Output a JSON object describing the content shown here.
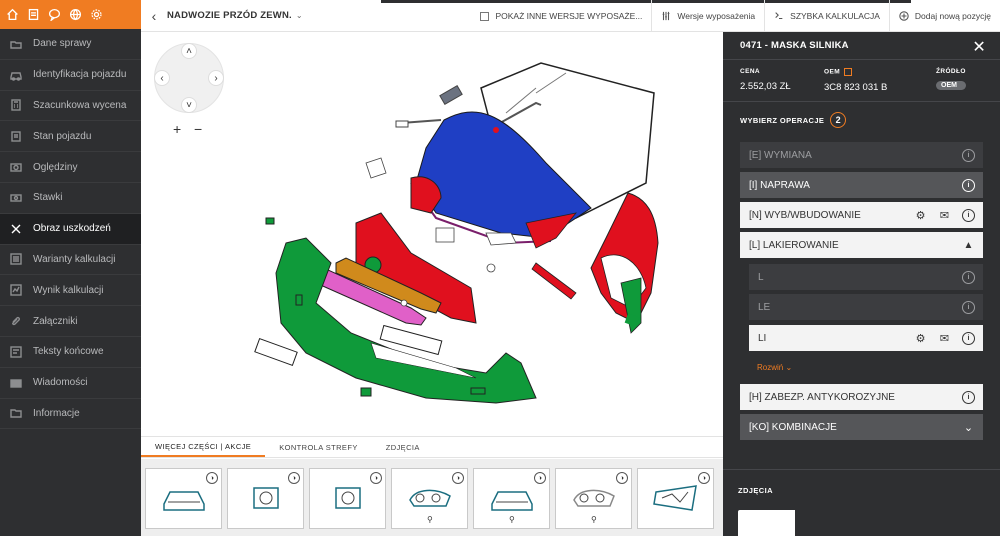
{
  "sidebar": {
    "top_icons": [
      "home-icon",
      "document-icon",
      "chat-icon",
      "globe-icon",
      "gear-icon"
    ],
    "items": [
      {
        "label": "Dane sprawy",
        "icon": "folder-icon"
      },
      {
        "label": "Identyfikacja pojazdu",
        "icon": "car-icon"
      },
      {
        "label": "Szacunkowa wycena",
        "icon": "calculator-icon"
      },
      {
        "label": "Stan pojazdu",
        "icon": "clipboard-icon"
      },
      {
        "label": "Oględziny",
        "icon": "camera-icon"
      },
      {
        "label": "Stawki",
        "icon": "money-icon"
      },
      {
        "label": "Obraz uszkodzeń",
        "icon": "tools-icon",
        "active": true
      },
      {
        "label": "Warianty kalkulacji",
        "icon": "list-icon"
      },
      {
        "label": "Wynik kalkulacji",
        "icon": "result-icon"
      },
      {
        "label": "Załączniki",
        "icon": "paperclip-icon"
      },
      {
        "label": "Teksty końcowe",
        "icon": "text-icon"
      },
      {
        "label": "Wiadomości",
        "icon": "mail-icon"
      },
      {
        "label": "Informacje",
        "icon": "info-folder-icon"
      }
    ]
  },
  "topbar": {
    "title": "NADWOZIE PRZÓD ZEWN.",
    "show_other_versions": "POKAŻ INNE WERSJE WYPOSAŻE...",
    "equipment_versions": "Wersje wyposażenia",
    "quick_calc": "SZYBKA KALKULACJA",
    "add_position": "Dodaj nową pozycję"
  },
  "bottom_tabs": [
    "WIĘCEJ CZĘŚCI | AKCJE",
    "KONTROLA STREFY",
    "ZDJĘCIA"
  ],
  "thumbnails": [
    {
      "name": "front-car-thumb",
      "tool": false
    },
    {
      "name": "grille-thumb",
      "tool": false
    },
    {
      "name": "emblem-thumb",
      "tool": false
    },
    {
      "name": "headlight-left-thumb",
      "tool": true
    },
    {
      "name": "front-car-2-thumb",
      "tool": true
    },
    {
      "name": "headlight-right-thumb",
      "tool": true
    },
    {
      "name": "panel-thumb",
      "tool": false
    }
  ],
  "panel": {
    "title": "0471 - MASKA SILNIKA",
    "cena_label": "CENA",
    "cena_value": "2.552,03 ZŁ",
    "oem_label": "OEM",
    "oem_value": "3C8 823 031 B",
    "zrodlo_label": "ŹRÓDŁO",
    "zrodlo_value": "OEM",
    "ops_title": "WYBIERZ OPERACJE",
    "ops_count": "2",
    "operations": [
      {
        "label": "[E] WYMIANA"
      },
      {
        "label": "[I] NAPRAWA"
      },
      {
        "label": "[N] WYB/WBUDOWANIE"
      },
      {
        "label": "[L] LAKIEROWANIE"
      },
      {
        "label": "L"
      },
      {
        "label": "LE"
      },
      {
        "label": "LI"
      },
      {
        "label": "[H] ZABEZP. ANTYKOROZYJNE"
      },
      {
        "label": "[KO] KOMBINACJE"
      }
    ],
    "expand_label": "Rozwiń",
    "photos_label": "ZDJĘCIA"
  },
  "colors": {
    "accent": "#f07c22",
    "sidebar_bg": "#2e2f31",
    "hood_blue": "#1f3fc4",
    "part_red": "#e0101e",
    "part_green": "#0f9a3a",
    "part_orange": "#d08a1c",
    "part_pink": "#e060c8"
  }
}
